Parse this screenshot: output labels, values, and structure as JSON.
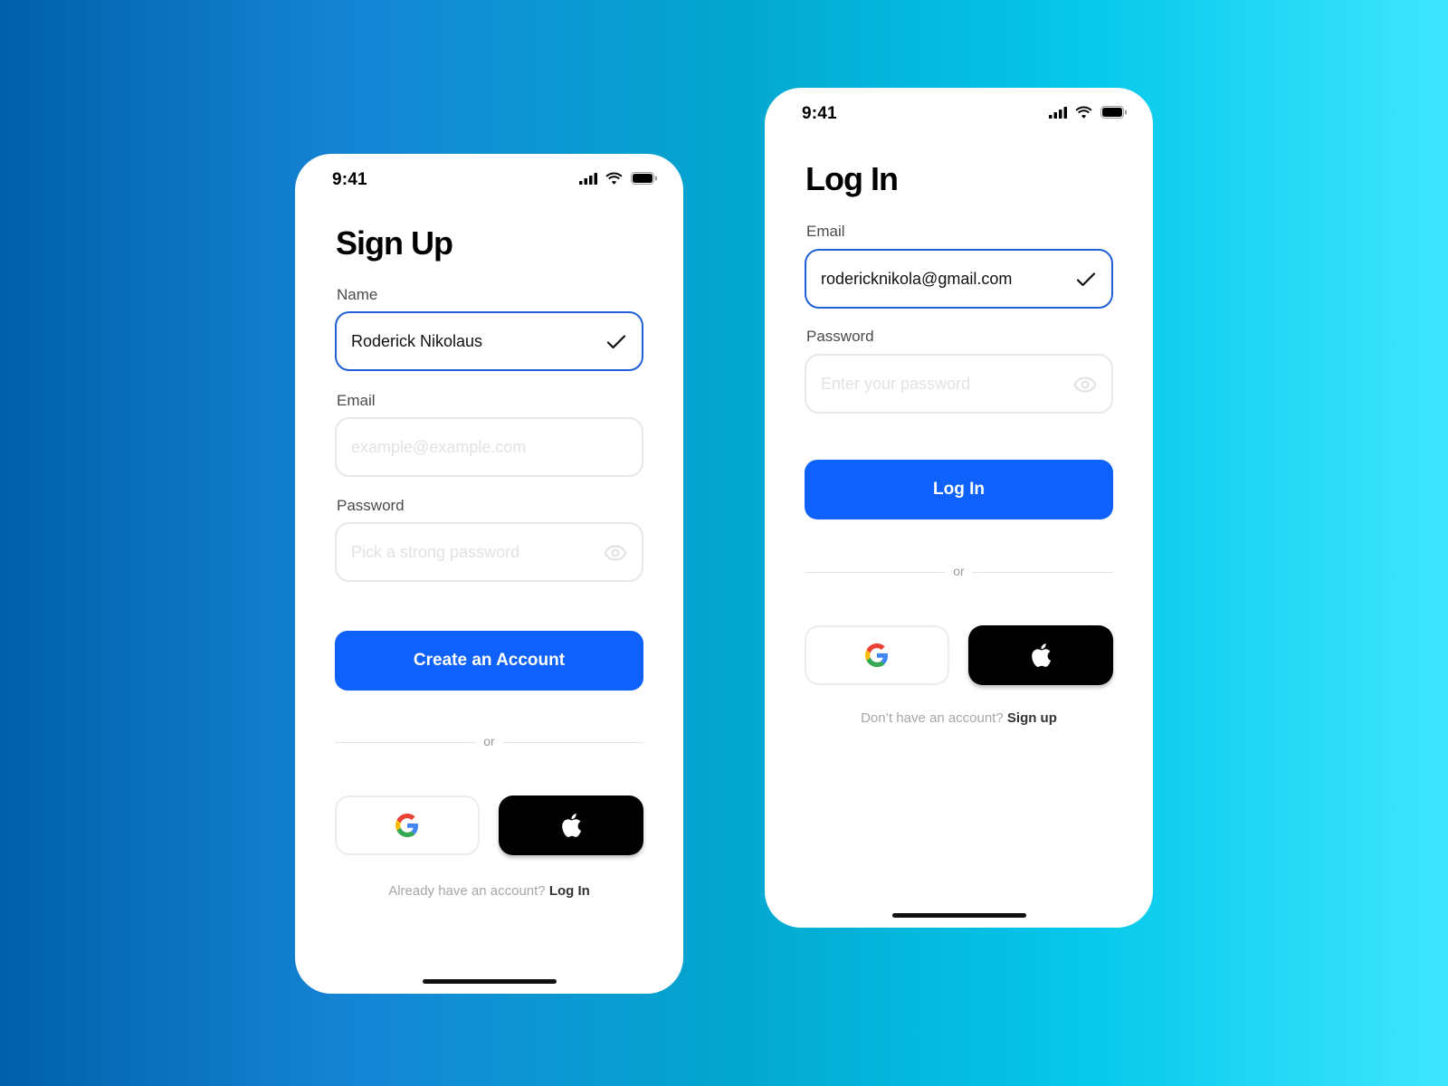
{
  "colors": {
    "accent": "#0e62fb",
    "active_border": "#1f5fd6",
    "apple_button": "#000000"
  },
  "signup": {
    "status_time": "9:41",
    "title": "Sign Up",
    "name_label": "Name",
    "name_value": "Roderick Nikolaus",
    "email_label": "Email",
    "email_placeholder": "example@example.com",
    "password_label": "Password",
    "password_placeholder": "Pick a strong password",
    "primary_button": "Create an Account",
    "divider_text": "or",
    "footer_text": "Already have an account?",
    "footer_link": "Log In",
    "icons": {
      "name_field": "checkmark-icon",
      "password_field": "eye-icon",
      "google": "google-icon",
      "apple": "apple-icon"
    }
  },
  "login": {
    "status_time": "9:41",
    "title": "Log In",
    "email_label": "Email",
    "email_value": "rodericknikola@gmail.com",
    "password_label": "Password",
    "password_placeholder": "Enter your password",
    "primary_button": "Log In",
    "divider_text": "or",
    "footer_text": "Don’t have an account?",
    "footer_link": "Sign up",
    "icons": {
      "email_field": "checkmark-icon",
      "password_field": "eye-icon",
      "google": "google-icon",
      "apple": "apple-icon"
    }
  }
}
